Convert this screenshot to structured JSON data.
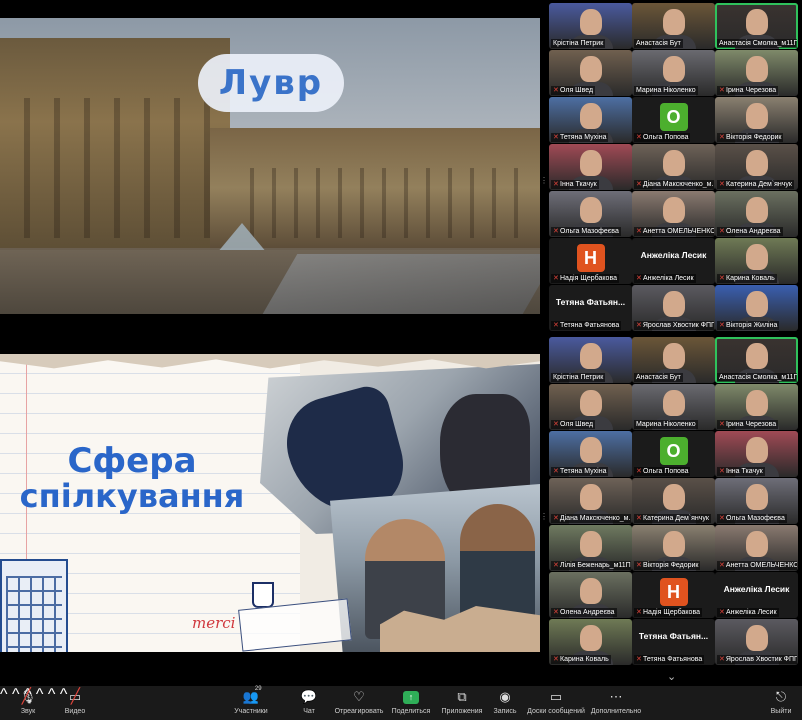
{
  "slide_top": {
    "title": "Лувр"
  },
  "slide_bottom": {
    "title_line1": "Сфера",
    "title_line2": "спілкування",
    "handwriting": "merci"
  },
  "gallery_top": [
    {
      "name": "Крістіна Петрик",
      "muted": false,
      "bg": "#4a5a9e"
    },
    {
      "name": "Анастасія Бут",
      "muted": false,
      "bg": "#6b5638"
    },
    {
      "name": "Анастасія Смолка_м11ПО",
      "muted": false,
      "bg": "#3a3330",
      "active": true
    },
    {
      "name": "Оля Швед",
      "muted": true,
      "bg": "#70604f"
    },
    {
      "name": "Марина Ніколенко",
      "muted": false,
      "bg": "#6a6a70"
    },
    {
      "name": "Ірина Черезова",
      "muted": true,
      "bg": "#7f8a6a"
    },
    {
      "name": "Тетяна Мухіна",
      "muted": true,
      "bg": "#4d6fa3"
    },
    {
      "name": "Ольга Попова",
      "muted": true,
      "letter": "О",
      "letter_bg": "#4caf2e"
    },
    {
      "name": "Вікторія Федорик",
      "muted": true,
      "bg": "#8a8070"
    },
    {
      "name": "Інна Ткачук",
      "muted": true,
      "bg": "#a04a55"
    },
    {
      "name": "Діана Максюченко_м...",
      "muted": true,
      "bg": "#6e6258"
    },
    {
      "name": "Катерина Дем`янчук",
      "muted": true,
      "bg": "#5a5048"
    },
    {
      "name": "Ольга Мазофеєва",
      "muted": true,
      "bg": "#6e6e78"
    },
    {
      "name": "Анетта ОМЕЛЬЧЕНКО",
      "muted": true,
      "bg": "#8a7a70"
    },
    {
      "name": "Олена Андреєва",
      "muted": true,
      "bg": "#6b7060"
    },
    {
      "name": "Надія Щербакова",
      "muted": true,
      "letter": "Н",
      "letter_bg": "#e0531f"
    },
    {
      "name": "Анжеліка Лесик",
      "muted": true,
      "big": "Анжеліка Лесик"
    },
    {
      "name": "Карина Коваль",
      "muted": true,
      "bg": "#6f7a55"
    },
    {
      "name": "Тетяна Фатьянова",
      "muted": true,
      "big": "Тетяна Фатьян..."
    },
    {
      "name": "Ярослав Хвостик ФПП...",
      "muted": true,
      "bg": "#5b5a60"
    },
    {
      "name": "Вікторія Жиліна",
      "muted": true,
      "bg": "#3a5fb0"
    }
  ],
  "gallery_bottom": [
    {
      "name": "Крістіна Петрик",
      "muted": false,
      "bg": "#4a5a9e"
    },
    {
      "name": "Анастасія Бут",
      "muted": false,
      "bg": "#6b5638"
    },
    {
      "name": "Анастасія Смолка_м11ПО",
      "muted": false,
      "bg": "#3a3330",
      "active": true
    },
    {
      "name": "Оля Швед",
      "muted": true,
      "bg": "#70604f"
    },
    {
      "name": "Марина Ніколенко",
      "muted": false,
      "bg": "#6a6a70"
    },
    {
      "name": "Ірина Черезова",
      "muted": true,
      "bg": "#7f8a6a"
    },
    {
      "name": "Тетяна Мухіна",
      "muted": true,
      "bg": "#4d6fa3"
    },
    {
      "name": "Ольга Попова",
      "muted": true,
      "letter": "О",
      "letter_bg": "#4caf2e"
    },
    {
      "name": "Інна Ткачук",
      "muted": true,
      "bg": "#a04a55"
    },
    {
      "name": "Діана Максюченко_м...",
      "muted": true,
      "bg": "#6e6258"
    },
    {
      "name": "Катерина Дем`янчук",
      "muted": true,
      "bg": "#5a5048"
    },
    {
      "name": "Ольга Мазофеєва",
      "muted": true,
      "bg": "#6e6e78"
    },
    {
      "name": "Лілія Беженарь_м11П...",
      "muted": true,
      "bg": "#6f7a60"
    },
    {
      "name": "Вікторія Федорик",
      "muted": true,
      "bg": "#8a8070"
    },
    {
      "name": "Анетта ОМЕЛЬЧЕНКО",
      "muted": true,
      "bg": "#8a7a70"
    },
    {
      "name": "Олена Андреєва",
      "muted": true,
      "bg": "#6b7060"
    },
    {
      "name": "Надія Щербакова",
      "muted": true,
      "letter": "Н",
      "letter_bg": "#e0531f"
    },
    {
      "name": "Анжеліка Лесик",
      "muted": true,
      "big": "Анжеліка Лесик"
    },
    {
      "name": "Карина Коваль",
      "muted": true,
      "bg": "#6f7a55"
    },
    {
      "name": "Тетяна Фатьянова",
      "muted": true,
      "big": "Тетяна Фатьян..."
    },
    {
      "name": "Ярослав Хвостик ФПП...",
      "muted": true,
      "bg": "#5b5a60"
    }
  ],
  "toolbar": {
    "audio": "Звук",
    "video": "Видео",
    "participants": "Участники",
    "participants_count": "29",
    "chat": "Чат",
    "react": "Отреагировать",
    "share": "Поделиться",
    "apps": "Приложения",
    "record": "Запись",
    "whiteboards": "Доски сообщений",
    "more": "Дополнительно",
    "leave": "Выйти"
  },
  "colors": {
    "accent_green": "#2fc25c",
    "muted_red": "#e0443b",
    "slide_title_blue": "#2a66c9"
  }
}
